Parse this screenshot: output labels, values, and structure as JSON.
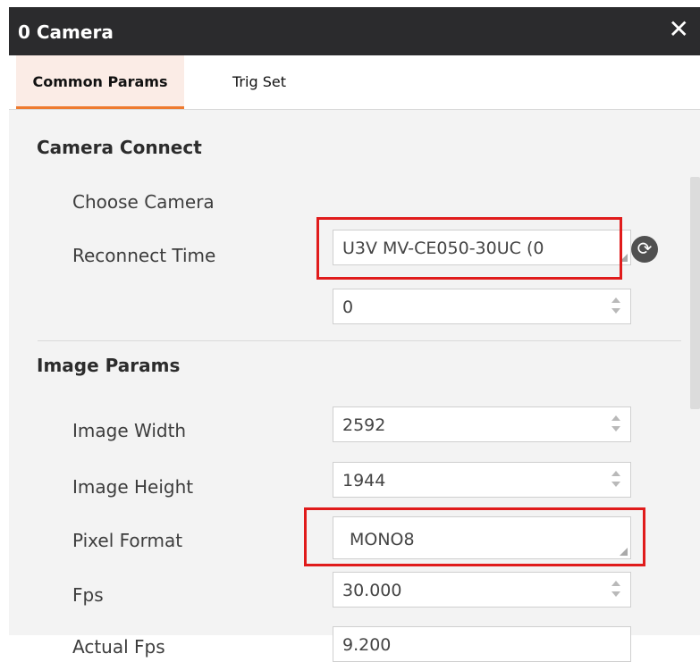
{
  "window": {
    "title": "0 Camera",
    "close_glyph": "✕"
  },
  "tabs": [
    {
      "label": "Common Params",
      "active": true
    },
    {
      "label": "Trig Set",
      "active": false
    }
  ],
  "sections": {
    "camera_connect": {
      "heading": "Camera Connect",
      "choose_camera": {
        "label": "Choose Camera",
        "value": "U3V MV-CE050-30UC (0"
      },
      "reconnect_time": {
        "label": "Reconnect Time",
        "value": "0"
      },
      "refresh_icon_glyph": "⟳"
    },
    "image_params": {
      "heading": "Image Params",
      "image_width": {
        "label": "Image Width",
        "value": "2592"
      },
      "image_height": {
        "label": "Image Height",
        "value": "1944"
      },
      "pixel_format": {
        "label": "Pixel Format",
        "value": "MONO8"
      },
      "fps": {
        "label": "Fps",
        "value": "30.000"
      },
      "actual_fps": {
        "label": "Actual Fps",
        "value": "9.200"
      }
    }
  },
  "colors": {
    "titlebar": "#2b2b2d",
    "tab_active_bg": "#fbece6",
    "tab_active_underline": "#ee7a2f",
    "highlight_box": "#e01b1b",
    "panel_bg": "#f3f3f3"
  }
}
